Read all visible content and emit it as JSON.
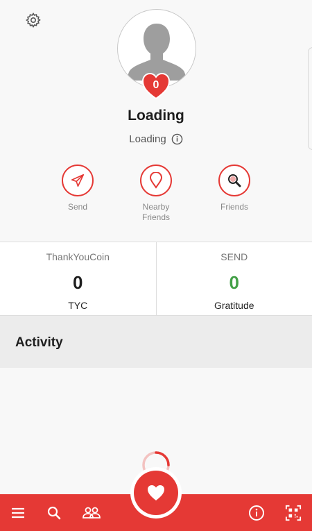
{
  "profile": {
    "name": "Loading",
    "status": "Loading",
    "heart_count": "0"
  },
  "actions": [
    {
      "label": "Send",
      "icon": "send-icon"
    },
    {
      "label": "Nearby\nFriends",
      "icon": "location-pin-icon"
    },
    {
      "label": "Friends",
      "icon": "search-icon"
    }
  ],
  "stats": {
    "coin": {
      "title": "ThankYouCoin",
      "value": "0",
      "unit": "TYC"
    },
    "send": {
      "title": "SEND",
      "value": "0",
      "unit": "Gratitude"
    }
  },
  "activity": {
    "title": "Activity"
  },
  "colors": {
    "accent": "#e53935",
    "green": "#43a047"
  }
}
